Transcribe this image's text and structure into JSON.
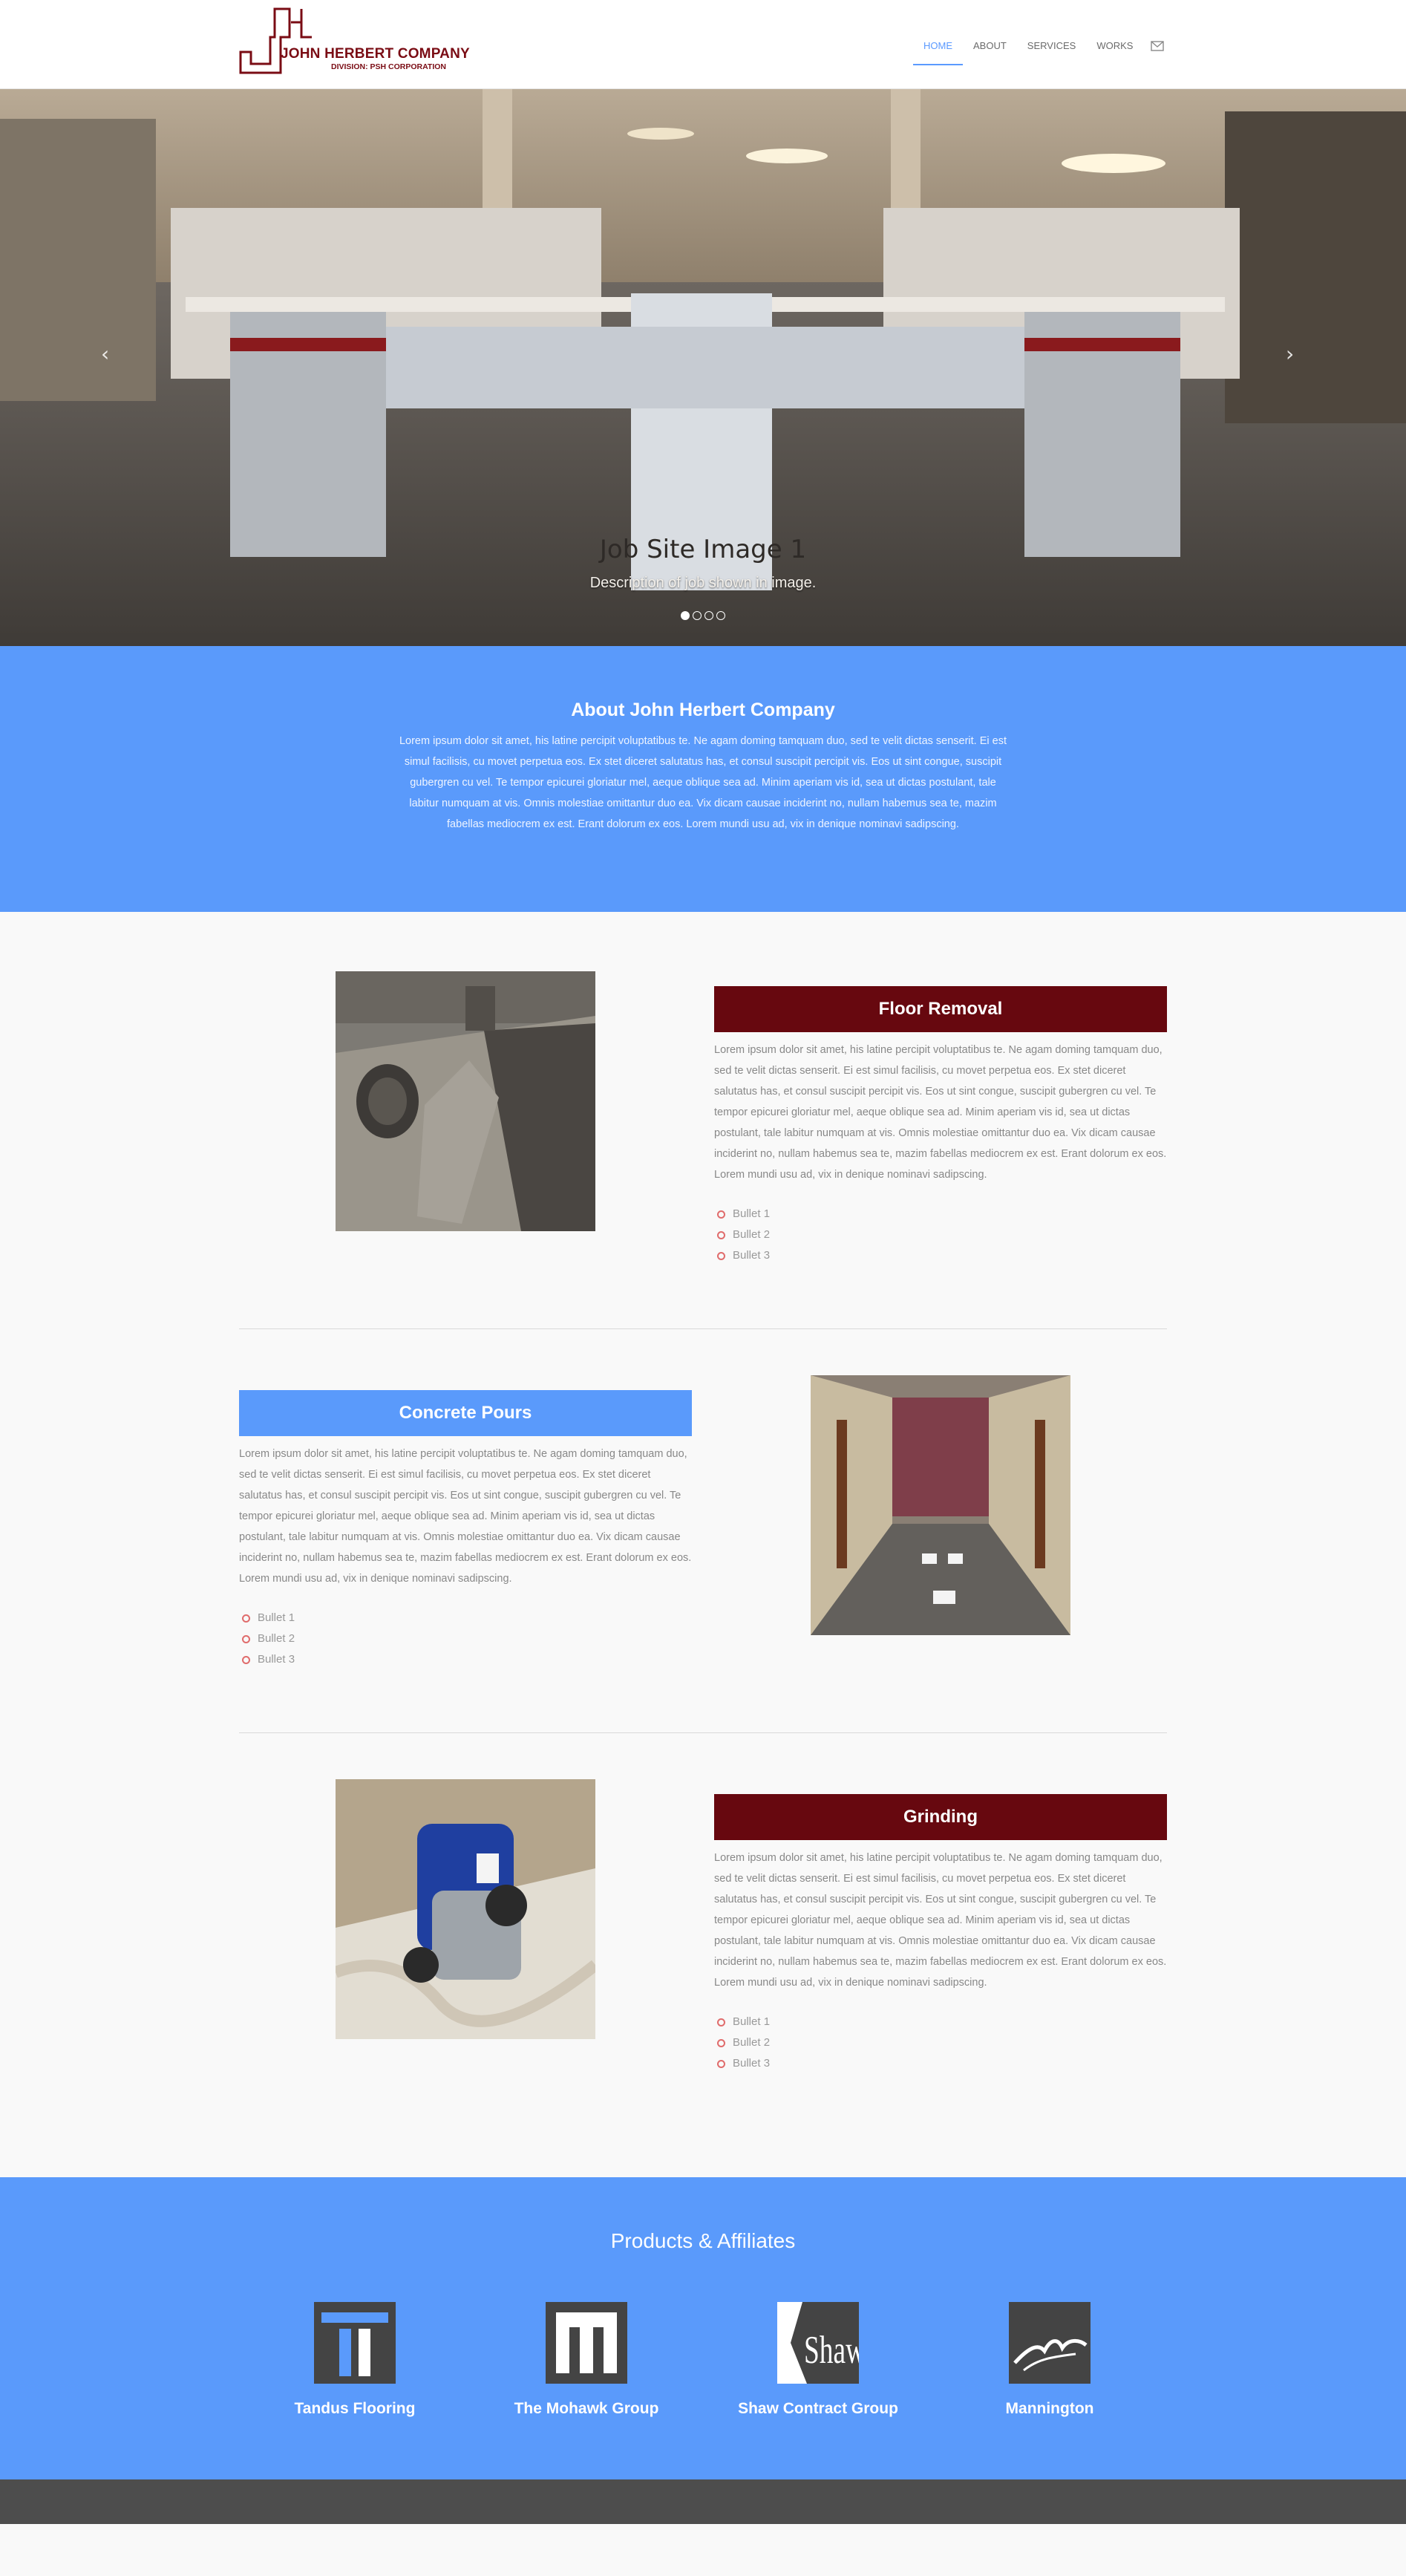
{
  "brand": {
    "name": "JOHN HERBERT COMPANY",
    "division": "DIVISION: PSH CORPORATION",
    "color": "#7a0c14"
  },
  "nav": {
    "items": [
      "HOME",
      "ABOUT",
      "SERVICES",
      "WORKS"
    ],
    "active": "HOME",
    "mail_icon": "envelope-icon"
  },
  "hero": {
    "title": "Job Site Image 1",
    "description": "Description of job shown in image.",
    "slide_count": 4,
    "active_slide": 1,
    "prev_icon": "chevron-left-icon",
    "next_icon": "chevron-right-icon"
  },
  "about": {
    "title": "About John Herbert Company",
    "text": "Lorem ipsum dolor sit amet, his latine percipit voluptatibus te. Ne agam doming tamquam duo, sed te velit dictas senserit. Ei est simul facilisis, cu movet perpetua eos. Ex stet diceret salutatus has, et consul suscipit percipit vis. Eos ut sint congue, suscipit gubergren cu vel. Te tempor epicurei gloriatur mel, aeque oblique sea ad. Minim aperiam vis id, sea ut dictas postulant, tale labitur numquam at vis. Omnis molestiae omittantur duo ea. Vix dicam causae inciderint no, nullam habemus sea te, mazim fabellas mediocrem ex est. Erant dolorum ex eos. Lorem mundi usu ad, vix in denique nominavi sadipscing.",
    "background": "#5a9afb"
  },
  "services": [
    {
      "title": "Floor Removal",
      "text": "Lorem ipsum dolor sit amet, his latine percipit voluptatibus te. Ne agam doming tamquam duo, sed te velit dictas senserit. Ei est simul facilisis, cu movet perpetua eos. Ex stet diceret salutatus has, et consul suscipit percipit vis. Eos ut sint congue, suscipit gubergren cu vel. Te tempor epicurei gloriatur mel, aeque oblique sea ad. Minim aperiam vis id, sea ut dictas postulant, tale labitur numquam at vis. Omnis molestiae omittantur duo ea. Vix dicam causae inciderint no, nullam habemus sea te, mazim fabellas mediocrem ex est. Erant dolorum ex eos. Lorem mundi usu ad, vix in denique nominavi sadipscing.",
      "bullets": [
        "Bullet 1",
        "Bullet 2",
        "Bullet 3"
      ],
      "title_color": "#67080f"
    },
    {
      "title": "Concrete Pours",
      "text": "Lorem ipsum dolor sit amet, his latine percipit voluptatibus te. Ne agam doming tamquam duo, sed te velit dictas senserit. Ei est simul facilisis, cu movet perpetua eos. Ex stet diceret salutatus has, et consul suscipit percipit vis. Eos ut sint congue, suscipit gubergren cu vel. Te tempor epicurei gloriatur mel, aeque oblique sea ad. Minim aperiam vis id, sea ut dictas postulant, tale labitur numquam at vis. Omnis molestiae omittantur duo ea. Vix dicam causae inciderint no, nullam habemus sea te, mazim fabellas mediocrem ex est. Erant dolorum ex eos. Lorem mundi usu ad, vix in denique nominavi sadipscing.",
      "bullets": [
        "Bullet 1",
        "Bullet 2",
        "Bullet 3"
      ],
      "title_color": "#5a9afb"
    },
    {
      "title": "Grinding",
      "text": "Lorem ipsum dolor sit amet, his latine percipit voluptatibus te. Ne agam doming tamquam duo, sed te velit dictas senserit. Ei est simul facilisis, cu movet perpetua eos. Ex stet diceret salutatus has, et consul suscipit percipit vis. Eos ut sint congue, suscipit gubergren cu vel. Te tempor epicurei gloriatur mel, aeque oblique sea ad. Minim aperiam vis id, sea ut dictas postulant, tale labitur numquam at vis. Omnis molestiae omittantur duo ea. Vix dicam causae inciderint no, nullam habemus sea te, mazim fabellas mediocrem ex est. Erant dolorum ex eos. Lorem mundi usu ad, vix in denique nominavi sadipscing.",
      "bullets": [
        "Bullet 1",
        "Bullet 2",
        "Bullet 3"
      ],
      "title_color": "#67080f"
    }
  ],
  "products": {
    "title": "Products & Affiliates",
    "affiliates": [
      {
        "name": "Tandus Flooring",
        "icon": "tandus-logo-icon"
      },
      {
        "name": "The Mohawk Group",
        "icon": "mohawk-logo-icon"
      },
      {
        "name": "Shaw Contract Group",
        "icon": "shaw-logo-icon",
        "logo_text": "Shaw"
      },
      {
        "name": "Mannington",
        "icon": "mannington-logo-icon"
      }
    ]
  }
}
